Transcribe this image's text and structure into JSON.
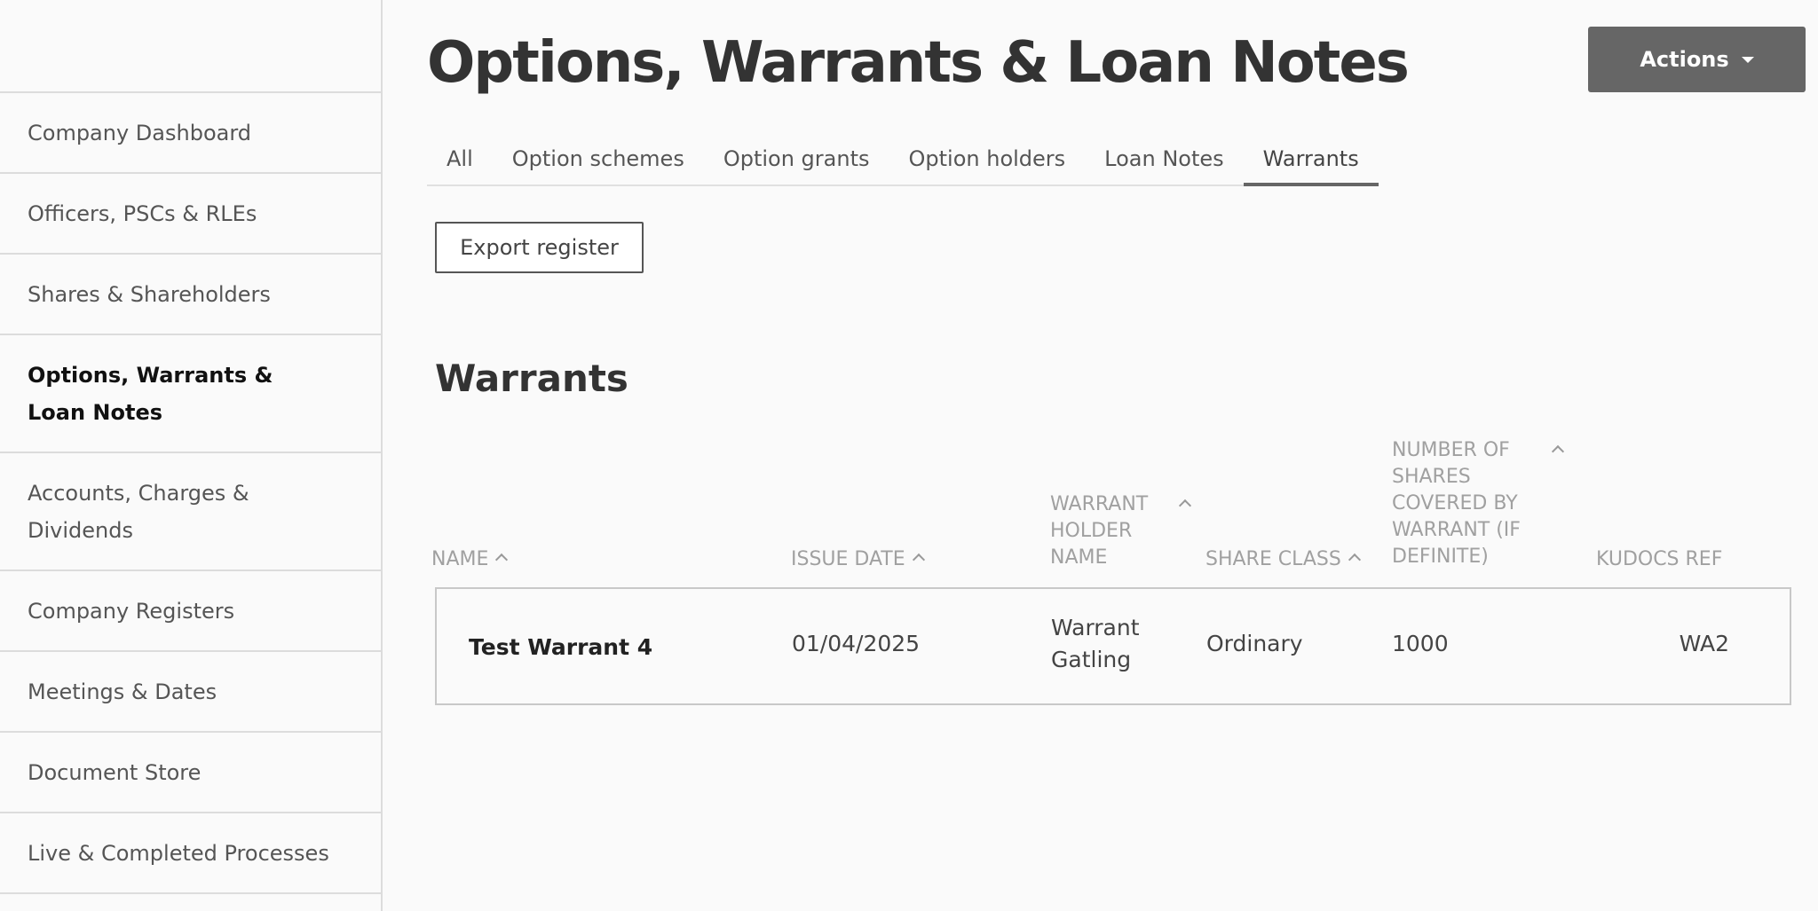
{
  "sidebar": {
    "items": [
      {
        "label": "Company Dashboard"
      },
      {
        "label": "Officers, PSCs & RLEs"
      },
      {
        "label": "Shares & Shareholders"
      },
      {
        "label": "Options, Warrants & Loan Notes",
        "active": true
      },
      {
        "label": "Accounts, Charges & Dividends"
      },
      {
        "label": "Company Registers"
      },
      {
        "label": "Meetings & Dates"
      },
      {
        "label": "Document Store"
      },
      {
        "label": "Live & Completed Processes"
      }
    ]
  },
  "header": {
    "title": "Options, Warrants & Loan Notes",
    "actions_label": "Actions"
  },
  "tabs": [
    {
      "label": "All"
    },
    {
      "label": "Option schemes"
    },
    {
      "label": "Option grants"
    },
    {
      "label": "Option holders"
    },
    {
      "label": "Loan Notes"
    },
    {
      "label": "Warrants",
      "active": true
    }
  ],
  "toolbar": {
    "export_label": "Export register"
  },
  "section": {
    "title": "Warrants"
  },
  "table": {
    "columns": [
      "NAME",
      "ISSUE DATE",
      "WARRANT HOLDER NAME",
      "SHARE CLASS",
      "NUMBER OF SHARES COVERED BY WARRANT (IF DEFINITE)",
      "KUDOCS REF"
    ],
    "rows": [
      {
        "name": "Test Warrant 4",
        "issue_date": "01/04/2025",
        "holder": "Warrant Gatling",
        "share_class": "Ordinary",
        "shares": "1000",
        "ref": "WA2"
      }
    ]
  }
}
